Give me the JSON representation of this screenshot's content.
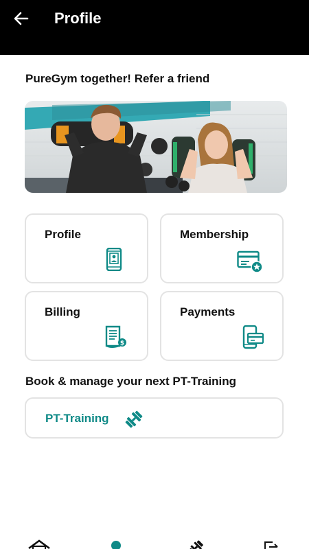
{
  "header": {
    "title": "Profile",
    "back_icon": "arrow-left-icon"
  },
  "referral": {
    "title": "PureGym together! Refer a friend",
    "banner_image": "photo of two people training with sandbags in gym"
  },
  "tiles": [
    {
      "label": "Profile",
      "icon": "phone-profile-icon"
    },
    {
      "label": "Membership",
      "icon": "membership-card-icon"
    },
    {
      "label": "Billing",
      "icon": "billing-document-icon"
    },
    {
      "label": "Payments",
      "icon": "phone-payment-icon"
    }
  ],
  "pt": {
    "heading": "Book & manage your next PT-Training",
    "button_label": "PT-Training",
    "icon": "dumbbell-icon"
  },
  "bottom_nav": [
    {
      "icon": "home-icon"
    },
    {
      "icon": "profile-icon"
    },
    {
      "icon": "training-icon"
    },
    {
      "icon": "logout-icon"
    }
  ],
  "colors": {
    "accent": "#0f8a87",
    "header_bg": "#000000",
    "tile_border": "#e3e3e3"
  }
}
